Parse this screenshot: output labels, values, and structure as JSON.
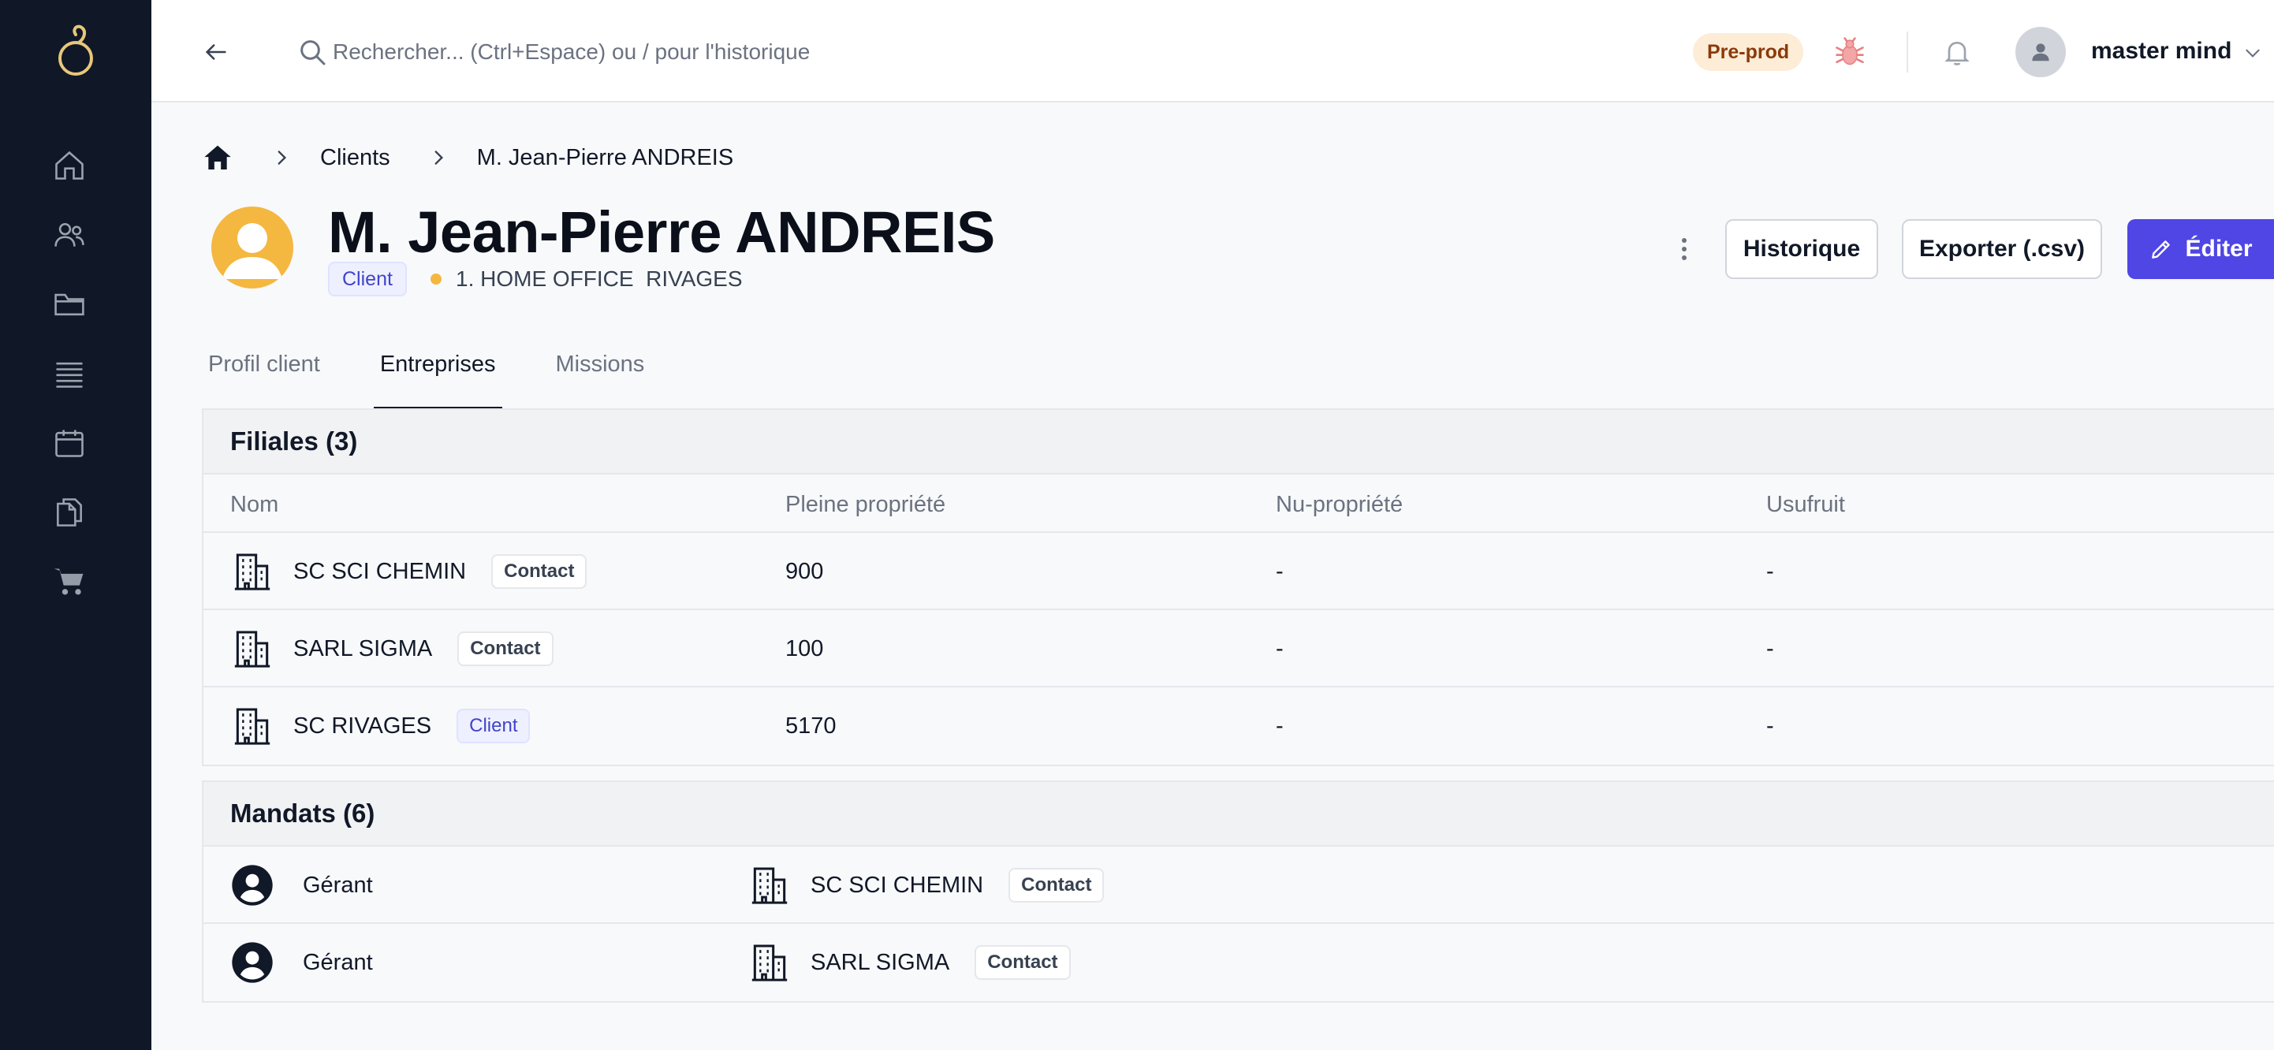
{
  "sidebar": {
    "logo_alt": "logo",
    "items": [
      {
        "name": "home"
      },
      {
        "name": "users"
      },
      {
        "name": "folder"
      },
      {
        "name": "list"
      },
      {
        "name": "calendar"
      },
      {
        "name": "documents"
      },
      {
        "name": "cart"
      }
    ]
  },
  "topbar": {
    "search_placeholder": "Rechercher... (Ctrl+Espace) ou / pour l'historique",
    "env_badge": "Pre-prod",
    "user_name": "master mind"
  },
  "breadcrumb": {
    "items": [
      "Clients",
      "M. Jean-Pierre ANDREIS"
    ]
  },
  "client": {
    "title": "M. Jean-Pierre ANDREIS",
    "type_badge": "Client",
    "office": "1. HOME OFFICE  RIVAGES"
  },
  "actions": {
    "history": "Historique",
    "export": "Exporter (.csv)",
    "edit": "Éditer"
  },
  "tabs": [
    "Profil client",
    "Entreprises",
    "Missions"
  ],
  "active_tab": "Entreprises",
  "filiales": {
    "title": "Filiales (3)",
    "columns": [
      "Nom",
      "Pleine propriété",
      "Nu-propriété",
      "Usufruit"
    ],
    "rows": [
      {
        "name": "SC SCI CHEMIN",
        "tag": "Contact",
        "pleine": "900",
        "nu": "-",
        "usufruit": "-"
      },
      {
        "name": "SARL SIGMA",
        "tag": "Contact",
        "pleine": "100",
        "nu": "-",
        "usufruit": "-"
      },
      {
        "name": "SC RIVAGES",
        "tag": "Client",
        "pleine": "5170",
        "nu": "-",
        "usufruit": "-"
      }
    ]
  },
  "mandats": {
    "title": "Mandats (6)",
    "rows": [
      {
        "role": "Gérant",
        "company": "SC SCI CHEMIN",
        "tag": "Contact"
      },
      {
        "role": "Gérant",
        "company": "SARL SIGMA",
        "tag": "Contact"
      }
    ]
  },
  "colors": {
    "sidebar_bg": "#101828",
    "accent": "#4f46e5",
    "avatar": "#f4b740",
    "logo": "#e8c77a",
    "env_badge_bg": "#fdecd6"
  }
}
